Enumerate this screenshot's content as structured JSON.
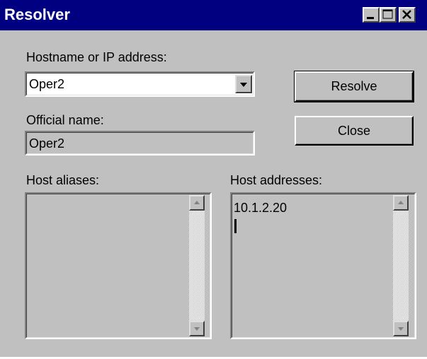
{
  "window": {
    "title": "Resolver",
    "controls": [
      "minimize-icon",
      "maximize-icon",
      "close-icon"
    ]
  },
  "hostname": {
    "label": "Hostname or IP address:",
    "value": "Oper2"
  },
  "official": {
    "label": "Official name:",
    "value": "Oper2"
  },
  "buttons": {
    "resolve": "Resolve",
    "close": "Close"
  },
  "aliases": {
    "label": "Host aliases:",
    "items": []
  },
  "addresses": {
    "label": "Host addresses:",
    "items": [
      "10.1.2.20"
    ]
  },
  "colors": {
    "titlebar": "#000080",
    "face": "#c0c0c0"
  }
}
